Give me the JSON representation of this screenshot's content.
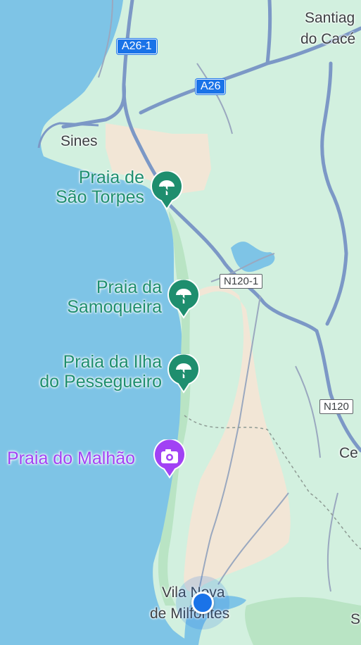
{
  "map": {
    "colors": {
      "water": "#7ec4e6",
      "land": "#d2f0df",
      "sand": "#f2e6d6",
      "park": "#b9e4c4",
      "highway": "#7c98c6",
      "beach_pin": "#1e8e6e",
      "photo_pin": "#a142f4",
      "location": "#1a73e8"
    },
    "towns": {
      "sines": "Sines",
      "santiago_l1": "Santiag",
      "santiago_l2": "do Cacé",
      "cercal": "Ce",
      "vnm_l1": "Vila Nova",
      "vnm_l2": "de Milfontes",
      "edge_s": "S"
    },
    "roads": {
      "a26_1": "A26-1",
      "a26": "A26",
      "n120_1": "N120-1",
      "n120": "N120"
    },
    "places": [
      {
        "l1": "Praia de",
        "l2": "São Torpes",
        "icon": "beach-umbrella-icon"
      },
      {
        "l1": "Praia da",
        "l2": "Samoqueira",
        "icon": "beach-umbrella-icon"
      },
      {
        "l1": "Praia da Ilha",
        "l2": "do Pessegueiro",
        "icon": "beach-umbrella-icon"
      },
      {
        "l1": "Praia do Malhão",
        "icon": "camera-icon"
      }
    ]
  }
}
